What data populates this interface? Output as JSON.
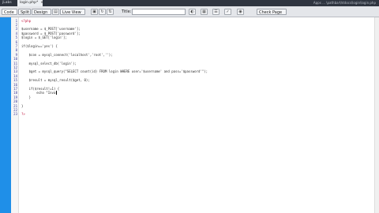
{
  "tabs": [
    {
      "label": "jLabs"
    },
    {
      "label": "login.php*",
      "close_glyph": "×"
    }
  ],
  "path_text": "Apps  ...  \\pathbar\\htdocs\\login\\login.php",
  "toolbar": {
    "code_label": "Code",
    "split_label": "Split",
    "design_label": "Design",
    "live_view_label": "Live View",
    "title_label": "Title:",
    "title_value": "",
    "check_page_label": "Check Page",
    "icons": [
      "inspect-icon",
      "multiscreen-icon",
      "refresh-icon",
      "file-management-icon",
      "preview-icon",
      "visual-aids-icon",
      "view-options-icon",
      "validate-icon",
      "browser-compat-icon"
    ]
  },
  "gutter_color": "#1f8fe8",
  "php_tag_color": "#c0143c",
  "editor": {
    "lines": [
      {
        "num": "1",
        "text": "<?php",
        "kind": "php"
      },
      {
        "num": "2",
        "text": "",
        "kind": "code"
      },
      {
        "num": "3",
        "text": "$username = $_POST['username'];",
        "kind": "code"
      },
      {
        "num": "4",
        "text": "$password = $_POST['password'];",
        "kind": "code"
      },
      {
        "num": "5",
        "text": "$login = $_GET['login'];",
        "kind": "code"
      },
      {
        "num": "6",
        "text": "",
        "kind": "code"
      },
      {
        "num": "7",
        "text": "if($login=='yes') {",
        "kind": "code"
      },
      {
        "num": "8",
        "text": "",
        "kind": "code"
      },
      {
        "num": "9",
        "text": "    $con = mysql_connect('localhost','root','');",
        "kind": "code"
      },
      {
        "num": "10",
        "text": "",
        "kind": "code"
      },
      {
        "num": "11",
        "text": "    mysql_select_db('login');",
        "kind": "code"
      },
      {
        "num": "12",
        "text": "",
        "kind": "code"
      },
      {
        "num": "13",
        "text": "    $get = mysql_query(\"SELECT count(id) FROM login WHERE user='$username' and pass='$password'\");",
        "kind": "code"
      },
      {
        "num": "14",
        "text": "",
        "kind": "code"
      },
      {
        "num": "15",
        "text": "    $result = mysql_result($get, 0);",
        "kind": "code"
      },
      {
        "num": "16",
        "text": "",
        "kind": "code"
      },
      {
        "num": "17",
        "text": "    if($result!=1) {",
        "kind": "code"
      },
      {
        "num": "18",
        "text": "        echo \"Inva",
        "kind": "code"
      },
      {
        "num": "19",
        "text": "    }",
        "kind": "code"
      },
      {
        "num": "20",
        "text": "",
        "kind": "code"
      },
      {
        "num": "21",
        "text": "}",
        "kind": "code"
      },
      {
        "num": "22",
        "text": "",
        "kind": "code"
      },
      {
        "num": "23",
        "text": "?>",
        "kind": "php"
      }
    ]
  }
}
